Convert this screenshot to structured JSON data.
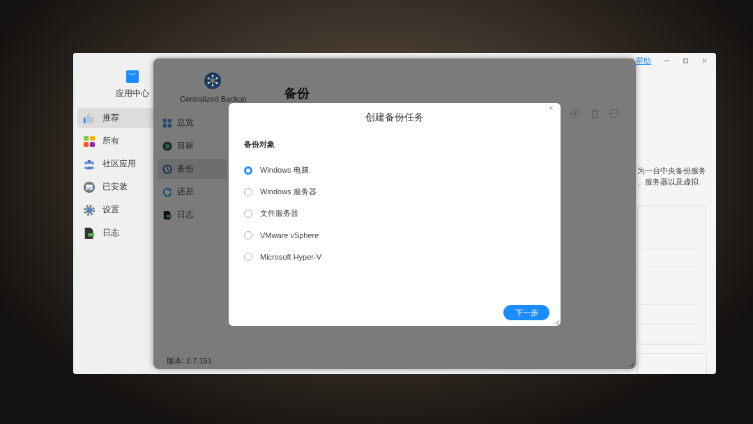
{
  "app_center": {
    "title": "应用中心",
    "help_link": "帮助",
    "nav": [
      {
        "label": "推荐",
        "selected": true
      },
      {
        "label": "所有",
        "selected": false
      },
      {
        "label": "社区应用",
        "selected": false
      },
      {
        "label": "已安装",
        "selected": false
      },
      {
        "label": "设置",
        "selected": false
      },
      {
        "label": "日志",
        "selected": false
      }
    ],
    "description_lines": [
      "为一台中央备份服务",
      "、服务器以及虚拟"
    ]
  },
  "backup_app": {
    "name": "Centralized Backup",
    "page_title": "备份",
    "version": "版本: 2.7.151",
    "nav": [
      {
        "label": "总览",
        "selected": false
      },
      {
        "label": "目标",
        "selected": false
      },
      {
        "label": "备份",
        "selected": true
      },
      {
        "label": "还原",
        "selected": false
      },
      {
        "label": "日志",
        "selected": false
      }
    ]
  },
  "dialog": {
    "title": "创建备份任务",
    "section_label": "备份对象",
    "options": [
      {
        "label": "Windows 电脑",
        "selected": true
      },
      {
        "label": "Windows 服务器",
        "selected": false
      },
      {
        "label": "文件服务器",
        "selected": false
      },
      {
        "label": "VMware vSphere",
        "selected": false
      },
      {
        "label": "Microsoft Hyper-V",
        "selected": false
      }
    ],
    "next_button": "下一步"
  }
}
